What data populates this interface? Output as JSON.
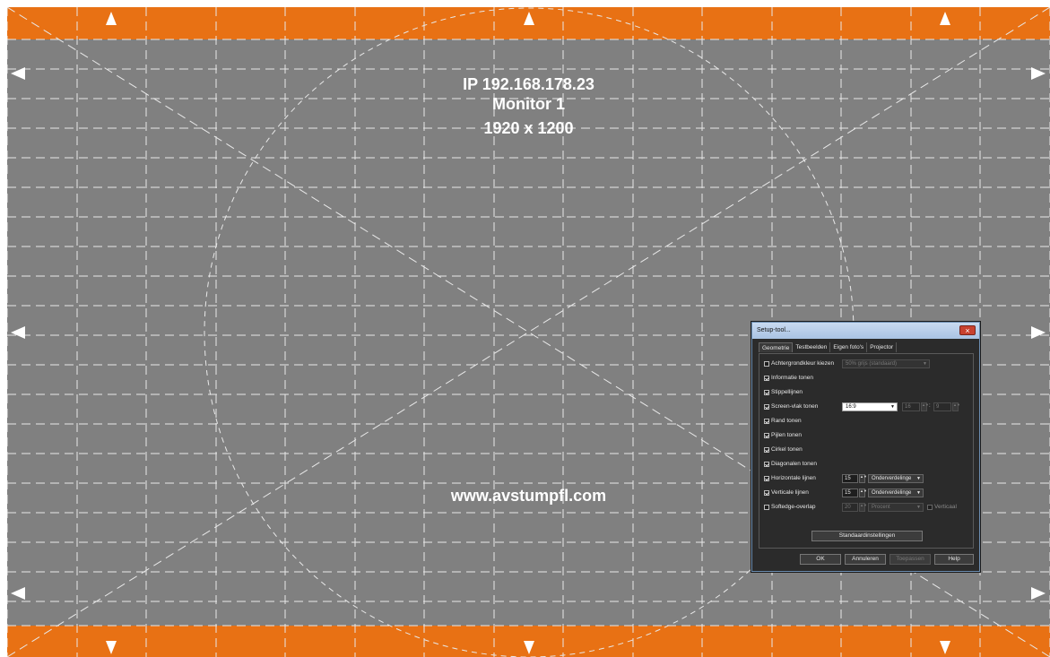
{
  "screen": {
    "ip": "IP 192.168.178.23",
    "monitor": "Monitor 1",
    "resolution": "1920 x 1200",
    "website": "www.avstumpfl.com",
    "band_color": "#e87114",
    "background_color": "#808080",
    "line_color": "#e8e8e8"
  },
  "dialog": {
    "title": "Setup-tool...",
    "close_icon": "close-icon",
    "tabs": [
      "Geometrie",
      "Testbeelden",
      "Eigen foto's",
      "Projector"
    ],
    "options": {
      "background": {
        "label": "Achtergrondkleur kiezen",
        "checked": false,
        "value": "50% grijs (standaard)"
      },
      "info": {
        "label": "Informatie tonen",
        "checked": true
      },
      "dotted": {
        "label": "Stippellijnen",
        "checked": true
      },
      "screen": {
        "label": "Screen-vlak tonen",
        "checked": true,
        "ratio": "16:9",
        "w": "16",
        "h": "9",
        "sep": ":"
      },
      "border": {
        "label": "Rand tonen",
        "checked": true
      },
      "arrows": {
        "label": "Pijlen tonen",
        "checked": true
      },
      "circle": {
        "label": "Cirkel tonen",
        "checked": true
      },
      "diagonals": {
        "label": "Diagonalen tonen",
        "checked": true
      },
      "hlines": {
        "label": "Horizontale lijnen",
        "checked": true,
        "value": "15",
        "mode": "Onderverdelinge"
      },
      "vlines": {
        "label": "Verticale lijnen",
        "checked": true,
        "value": "15",
        "mode": "Onderverdelinge"
      },
      "softedge": {
        "label": "Softedge-overlap",
        "checked": false,
        "value": "20",
        "unit": "Procent",
        "vertical": "Verticaal"
      }
    },
    "defaults_button": "Standaardinstellingen",
    "buttons": {
      "ok": "OK",
      "cancel": "Annuleren",
      "apply": "Toepassen",
      "help": "Help"
    }
  }
}
